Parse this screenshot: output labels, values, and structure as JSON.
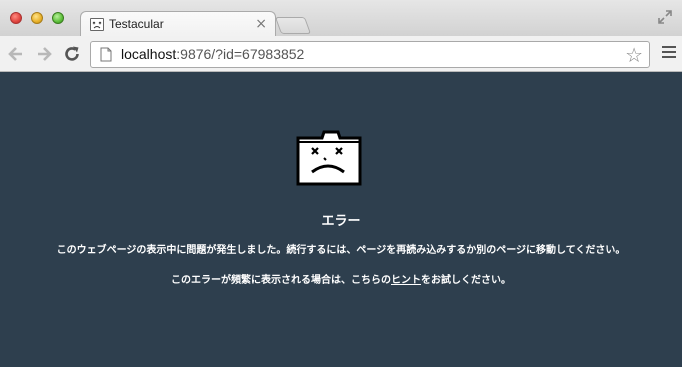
{
  "window": {
    "tab_title": "Testacular",
    "tab_close": "×",
    "url_host": "localhost",
    "url_rest": ":9876/?id=67983852"
  },
  "toolbar": {
    "back_icon": "arrow-left",
    "forward_icon": "arrow-right",
    "reload_icon": "reload",
    "bookmark_icon": "star"
  },
  "error_page": {
    "title": "エラー",
    "message": "このウェブページの表示中に問題が発生しました。続行するには、ページを再読み込みするか別のページに移動してください。",
    "hint_prefix": "このエラーが頻繁に表示される場合は、こちらの",
    "hint_link": "ヒント",
    "hint_suffix": "をお試しください。",
    "icon": "sad-folder"
  },
  "colors": {
    "page_bg": "#2e3f4e",
    "text": "#ffffff"
  }
}
